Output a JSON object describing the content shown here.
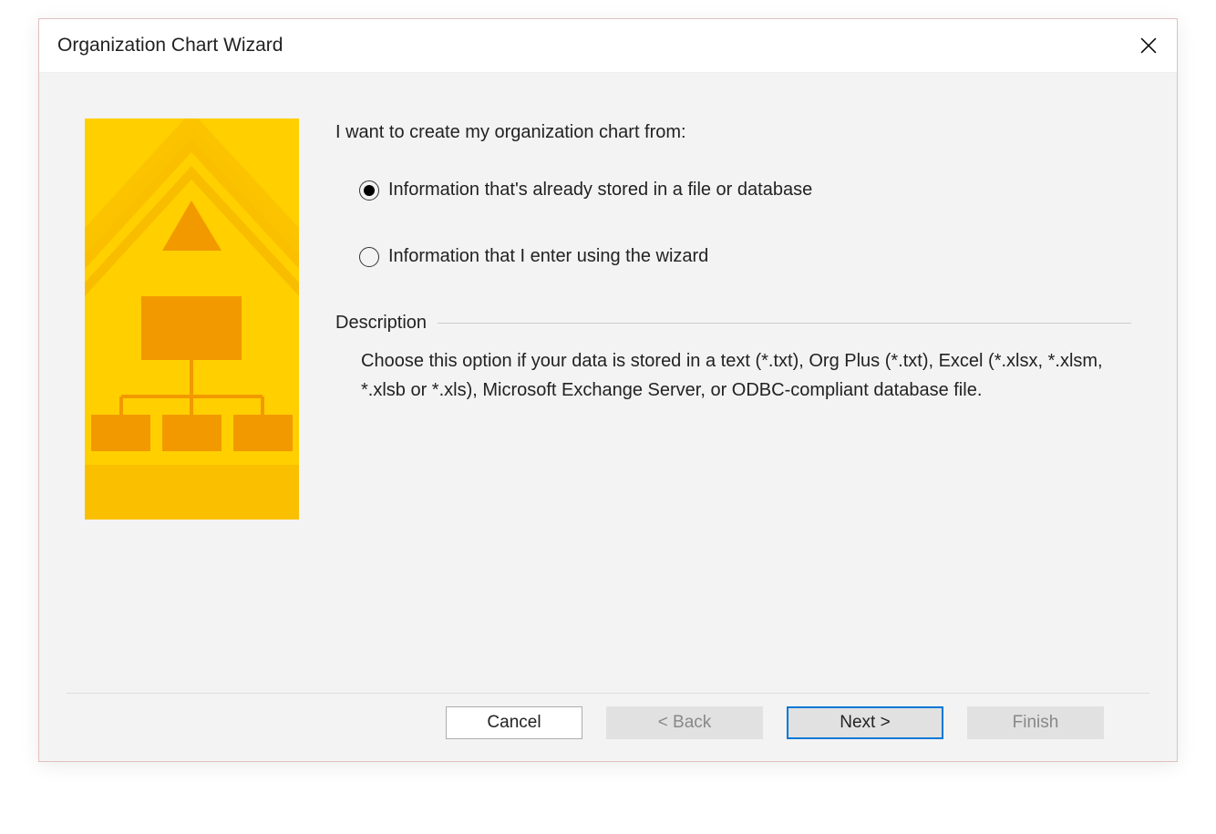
{
  "dialog": {
    "title": "Organization Chart Wizard"
  },
  "content": {
    "prompt": "I want to create my organization chart from:",
    "options": [
      {
        "label": "Information that's already stored in a file or database",
        "selected": true
      },
      {
        "label": "Information that I enter using the wizard",
        "selected": false
      }
    ],
    "description": {
      "title": "Description",
      "text": "Choose this option if your data is stored in a text (*.txt), Org Plus (*.txt), Excel (*.xlsx, *.xlsm, *.xlsb or *.xls), Microsoft Exchange Server, or ODBC-compliant database file."
    }
  },
  "buttons": {
    "cancel": "Cancel",
    "back": "< Back",
    "next": "Next >",
    "finish": "Finish"
  }
}
